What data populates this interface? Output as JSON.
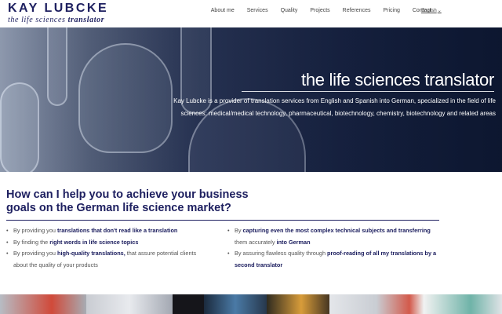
{
  "header": {
    "logo_name": "KAY LUBCKE",
    "logo_tagline_prefix": "the life sciences ",
    "logo_tagline_bold": "translator",
    "nav": [
      "About me",
      "Services",
      "Quality",
      "Projects",
      "References",
      "Pricing",
      "Contact"
    ],
    "language": "English"
  },
  "hero": {
    "title": "the life sciences translator",
    "text": "Kay Lubcke is a provider of translation services from English and Spanish into German, specialized in the field of life sciences: medical/medical technology, pharmaceutical, biotechnology, chemistry, biotechnology and related areas"
  },
  "main": {
    "headline": "How can I help you to achieve your business goals on the German life science market?",
    "left_items": [
      {
        "pre": "By providing you ",
        "hl": "translations that don't read like a translation",
        "post": ""
      },
      {
        "pre": "By finding the ",
        "hl": "right words in life science topics",
        "post": ""
      },
      {
        "pre": "By providing you ",
        "hl": "high-quality translations,",
        "post": " that assure potential clients about the quality of your products"
      }
    ],
    "right_items": [
      {
        "pre": "By ",
        "hl": "capturing even the most complex technical subjects and transferring",
        "post": " them accurately ",
        "hl2": "into German"
      },
      {
        "pre": "By assuring flawless quality through ",
        "hl": "proof-reading of all my translations by a second translator",
        "post": "",
        "hl2": ""
      }
    ]
  },
  "colors": {
    "brand_navy": "#1e2060",
    "body_text": "#555555",
    "hero_overlay": "#1b2646"
  }
}
